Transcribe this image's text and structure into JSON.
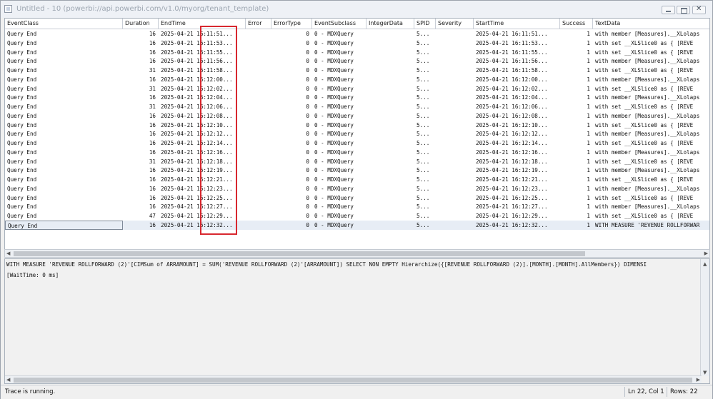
{
  "window": {
    "title": "Untitled - 10 (powerbi://api.powerbi.com/v1.0/myorg/tenant_template)"
  },
  "grid": {
    "columns": [
      "EventClass",
      "Duration",
      "EndTime",
      "Error",
      "ErrorType",
      "EventSubclass",
      "IntegerData",
      "SPID",
      "Severity",
      "StartTime",
      "Success",
      "TextData"
    ],
    "rows": [
      {
        "event": "Query End",
        "duration": "16",
        "end": "2025-04-21 16:11:51...",
        "errortype": "0",
        "subclass": "0 - MDXQuery",
        "spid": "5...",
        "start": "2025-04-21 16:11:51...",
        "success": "1",
        "text": "with member [Measures].__XLolaps"
      },
      {
        "event": "Query End",
        "duration": "16",
        "end": "2025-04-21 16:11:53...",
        "errortype": "0",
        "subclass": "0 - MDXQuery",
        "spid": "5...",
        "start": "2025-04-21 16:11:53...",
        "success": "1",
        "text": "with   set __XLSlice0 as { [REVE"
      },
      {
        "event": "Query End",
        "duration": "16",
        "end": "2025-04-21 16:11:55...",
        "errortype": "0",
        "subclass": "0 - MDXQuery",
        "spid": "5...",
        "start": "2025-04-21 16:11:55...",
        "success": "1",
        "text": "with   set __XLSlice0 as { [REVE"
      },
      {
        "event": "Query End",
        "duration": "16",
        "end": "2025-04-21 16:11:56...",
        "errortype": "0",
        "subclass": "0 - MDXQuery",
        "spid": "5...",
        "start": "2025-04-21 16:11:56...",
        "success": "1",
        "text": "with member [Measures].__XLolaps"
      },
      {
        "event": "Query End",
        "duration": "31",
        "end": "2025-04-21 16:11:58...",
        "errortype": "0",
        "subclass": "0 - MDXQuery",
        "spid": "5...",
        "start": "2025-04-21 16:11:58...",
        "success": "1",
        "text": "with   set __XLSlice0 as { [REVE"
      },
      {
        "event": "Query End",
        "duration": "16",
        "end": "2025-04-21 16:12:00...",
        "errortype": "0",
        "subclass": "0 - MDXQuery",
        "spid": "5...",
        "start": "2025-04-21 16:12:00...",
        "success": "1",
        "text": "with member [Measures].__XLolaps"
      },
      {
        "event": "Query End",
        "duration": "31",
        "end": "2025-04-21 16:12:02...",
        "errortype": "0",
        "subclass": "0 - MDXQuery",
        "spid": "5...",
        "start": "2025-04-21 16:12:02...",
        "success": "1",
        "text": "with   set __XLSlice0 as { [REVE"
      },
      {
        "event": "Query End",
        "duration": "16",
        "end": "2025-04-21 16:12:04...",
        "errortype": "0",
        "subclass": "0 - MDXQuery",
        "spid": "5...",
        "start": "2025-04-21 16:12:04...",
        "success": "1",
        "text": "with member [Measures].__XLolaps"
      },
      {
        "event": "Query End",
        "duration": "31",
        "end": "2025-04-21 16:12:06...",
        "errortype": "0",
        "subclass": "0 - MDXQuery",
        "spid": "5...",
        "start": "2025-04-21 16:12:06...",
        "success": "1",
        "text": "with   set __XLSlice0 as { [REVE"
      },
      {
        "event": "Query End",
        "duration": "16",
        "end": "2025-04-21 16:12:08...",
        "errortype": "0",
        "subclass": "0 - MDXQuery",
        "spid": "5...",
        "start": "2025-04-21 16:12:08...",
        "success": "1",
        "text": "with member [Measures].__XLolaps"
      },
      {
        "event": "Query End",
        "duration": "16",
        "end": "2025-04-21 16:12:10...",
        "errortype": "0",
        "subclass": "0 - MDXQuery",
        "spid": "5...",
        "start": "2025-04-21 16:12:10...",
        "success": "1",
        "text": "with   set __XLSlice0 as { [REVE"
      },
      {
        "event": "Query End",
        "duration": "16",
        "end": "2025-04-21 16:12:12...",
        "errortype": "0",
        "subclass": "0 - MDXQuery",
        "spid": "5...",
        "start": "2025-04-21 16:12:12...",
        "success": "1",
        "text": "with member [Measures].__XLolaps"
      },
      {
        "event": "Query End",
        "duration": "16",
        "end": "2025-04-21 16:12:14...",
        "errortype": "0",
        "subclass": "0 - MDXQuery",
        "spid": "5...",
        "start": "2025-04-21 16:12:14...",
        "success": "1",
        "text": "with   set __XLSlice0 as { [REVE"
      },
      {
        "event": "Query End",
        "duration": "16",
        "end": "2025-04-21 16:12:16...",
        "errortype": "0",
        "subclass": "0 - MDXQuery",
        "spid": "5...",
        "start": "2025-04-21 16:12:16...",
        "success": "1",
        "text": "with member [Measures].__XLolaps"
      },
      {
        "event": "Query End",
        "duration": "31",
        "end": "2025-04-21 16:12:18...",
        "errortype": "0",
        "subclass": "0 - MDXQuery",
        "spid": "5...",
        "start": "2025-04-21 16:12:18...",
        "success": "1",
        "text": "with   set __XLSlice0 as { [REVE"
      },
      {
        "event": "Query End",
        "duration": "16",
        "end": "2025-04-21 16:12:19...",
        "errortype": "0",
        "subclass": "0 - MDXQuery",
        "spid": "5...",
        "start": "2025-04-21 16:12:19...",
        "success": "1",
        "text": "with member [Measures].__XLolaps"
      },
      {
        "event": "Query End",
        "duration": "16",
        "end": "2025-04-21 16:12:21...",
        "errortype": "0",
        "subclass": "0 - MDXQuery",
        "spid": "5...",
        "start": "2025-04-21 16:12:21...",
        "success": "1",
        "text": "with   set __XLSlice0 as { [REVE"
      },
      {
        "event": "Query End",
        "duration": "16",
        "end": "2025-04-21 16:12:23...",
        "errortype": "0",
        "subclass": "0 - MDXQuery",
        "spid": "5...",
        "start": "2025-04-21 16:12:23...",
        "success": "1",
        "text": "with member [Measures].__XLolaps"
      },
      {
        "event": "Query End",
        "duration": "16",
        "end": "2025-04-21 16:12:25...",
        "errortype": "0",
        "subclass": "0 - MDXQuery",
        "spid": "5...",
        "start": "2025-04-21 16:12:25...",
        "success": "1",
        "text": "with   set __XLSlice0 as { [REVE"
      },
      {
        "event": "Query End",
        "duration": "16",
        "end": "2025-04-21 16:12:27...",
        "errortype": "0",
        "subclass": "0 - MDXQuery",
        "spid": "5...",
        "start": "2025-04-21 16:12:27...",
        "success": "1",
        "text": "with member [Measures].__XLolaps"
      },
      {
        "event": "Query End",
        "duration": "47",
        "end": "2025-04-21 16:12:29...",
        "errortype": "0",
        "subclass": "0 - MDXQuery",
        "spid": "5...",
        "start": "2025-04-21 16:12:29...",
        "success": "1",
        "text": "with   set __XLSlice0 as { [REVE"
      },
      {
        "event": "Query End",
        "duration": "16",
        "end": "2025-04-21 16:12:32...",
        "errortype": "0",
        "subclass": "0 - MDXQuery",
        "spid": "5...",
        "start": "2025-04-21 16:12:32...",
        "success": "1",
        "text": "WITH MEASURE 'REVENUE ROLLFORWAR"
      }
    ],
    "selected_row": 22
  },
  "detail": {
    "line1": "WITH MEASURE 'REVENUE ROLLFORWARD (2)'[CIMSum of ARRAMOUNT] = SUM('REVENUE ROLLFORWARD (2)'[ARRAMOUNT])  SELECT NON EMPTY Hierarchize({[REVENUE ROLLFORWARD (2)].[MONTH].[MONTH].AllMembers}) DIMENSI",
    "line2": "[WaitTime: 0 ms]"
  },
  "status": {
    "message": "Trace is running.",
    "position": "Ln 22, Col 1",
    "rows": "Rows: 22"
  },
  "colors": {
    "highlight_box": "#d8282f"
  }
}
